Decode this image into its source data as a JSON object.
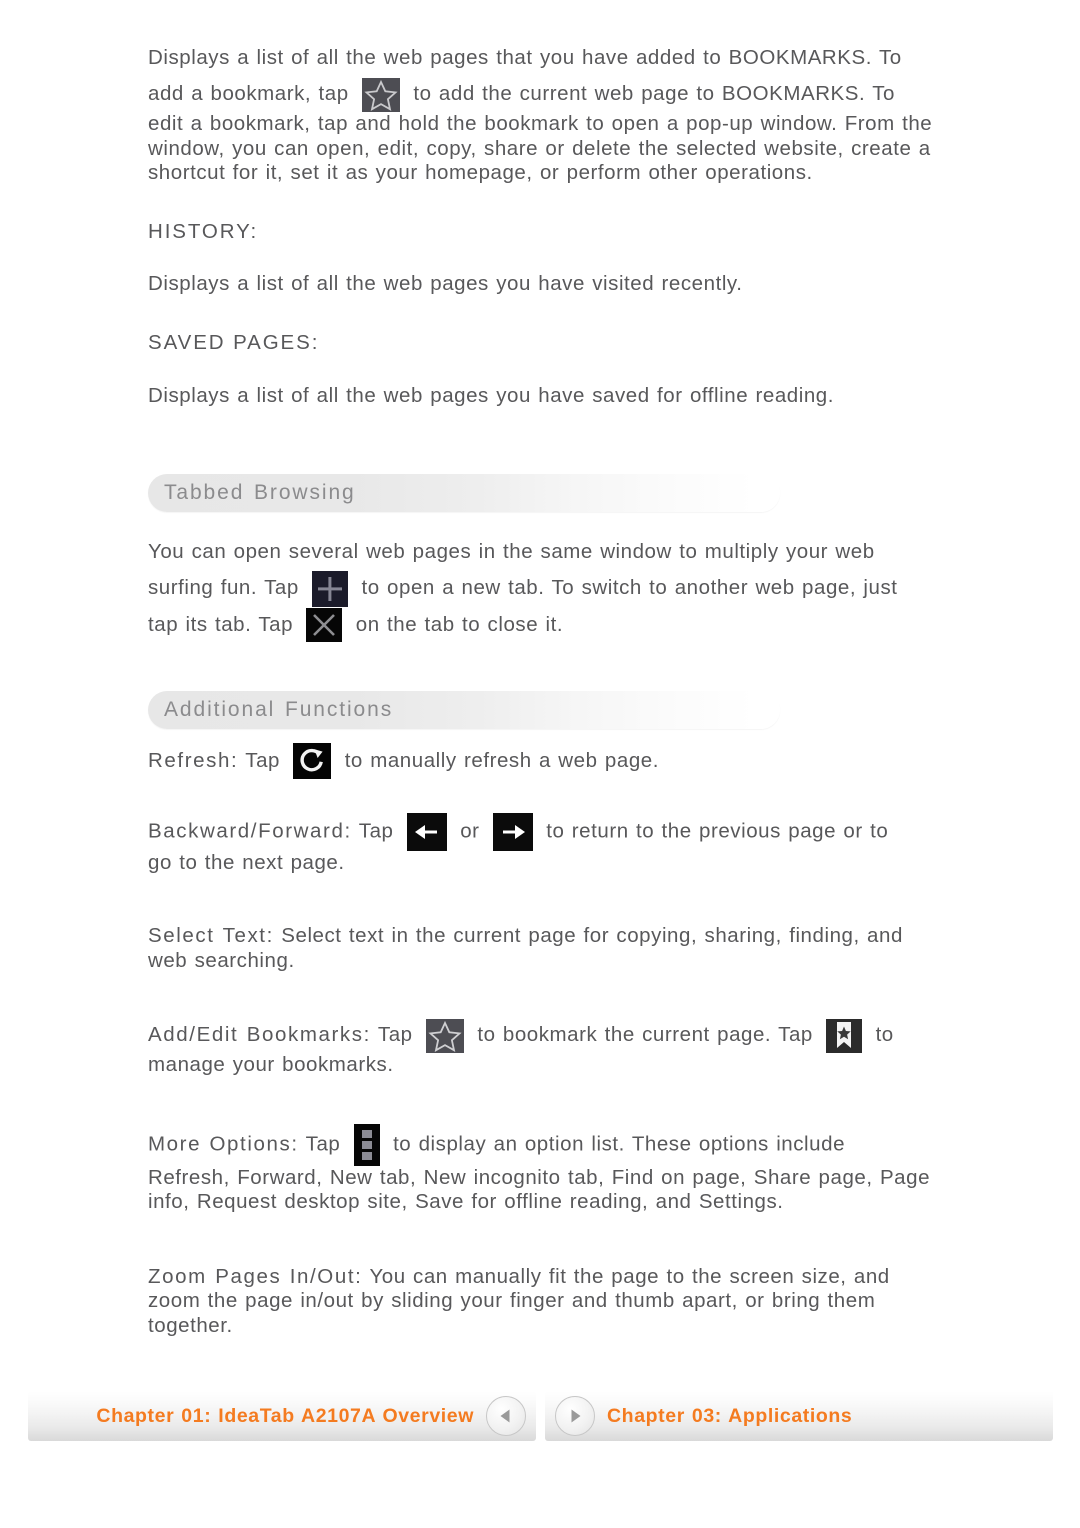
{
  "document": {
    "paragraphs": {
      "bookmarks_intro_a": "Displays a list of all the web pages that you have added to BOOKMARKS. To",
      "bookmarks_intro_b": "add a bookmark, tap",
      "bookmarks_intro_c": "to add the current web page to BOOKMARKS. To",
      "bookmarks_intro_rest": "edit a bookmark, tap and hold the bookmark to open a pop-up window. From the window, you can open, edit, copy, share or delete the selected website, create a shortcut for it, set it as your homepage, or perform other operations.",
      "history_label": "HISTORY:",
      "history_text": "Displays a list of all the web pages you have visited recently.",
      "saved_pages_label": "SAVED PAGES:",
      "saved_pages_text": "Displays a list of all the web pages you have saved for offline reading."
    },
    "sections": [
      {
        "id": "tabbed-browsing",
        "title": "Tabbed Browsing",
        "line_a": "You can open several web pages in the same window to multiply your web",
        "line_b_pre": "surfing fun. Tap",
        "line_b_post": "to open a new tab. To switch to another web page, just",
        "line_c_pre": "tap its tab. Tap",
        "line_c_post": "on the tab to close it."
      },
      {
        "id": "additional-functions",
        "title": "Additional Functions",
        "items": [
          {
            "id": "refresh",
            "lead": "Refresh:",
            "pre": "Tap",
            "post": "to manually refresh a web page."
          },
          {
            "id": "backward-forward",
            "lead": "Backward/Forward:",
            "pre": "Tap",
            "middle": "or",
            "post": "to return to the previous page or to",
            "wrap": "go to the next page."
          },
          {
            "id": "select-text",
            "lead": "Select Text:",
            "text": "Select text in the current page for copying, sharing, finding, and web searching."
          },
          {
            "id": "add-edit-bookmarks",
            "lead": "Add/Edit Bookmarks:",
            "pre": "Tap",
            "middle": "to bookmark the current page. Tap",
            "post": "to",
            "wrap": "manage your bookmarks."
          },
          {
            "id": "more-options",
            "lead": "More Options:",
            "pre": "Tap",
            "post": "to display an option list. These options include",
            "wrap": "Refresh, Forward, New tab, New incognito tab, Find on page, Share page, Page info, Request desktop site, Save for offline reading, and Settings."
          },
          {
            "id": "zoom-pages",
            "lead": "Zoom Pages In/Out:",
            "text": "You can manually fit the page to the screen size, and zoom the page in/out by sliding your finger and thumb apart, or bring them together."
          }
        ]
      }
    ]
  },
  "icons": {
    "star_outline": "star-outline-icon",
    "plus": "plus-icon",
    "close": "close-icon",
    "refresh": "refresh-icon",
    "arrow_left": "arrow-left-icon",
    "arrow_right": "arrow-right-icon",
    "bookmark": "bookmark-icon",
    "more": "more-options-icon"
  },
  "footer": {
    "prev_label": "Chapter 01: IdeaTab A2107A Overview",
    "next_label": "Chapter 03: Applications"
  },
  "colors": {
    "text": "#58585a",
    "section_title": "#8b8b8d",
    "footer_link": "#f47b20",
    "bar_start": "#e7e7e7",
    "bar_end": "#ffffff"
  }
}
